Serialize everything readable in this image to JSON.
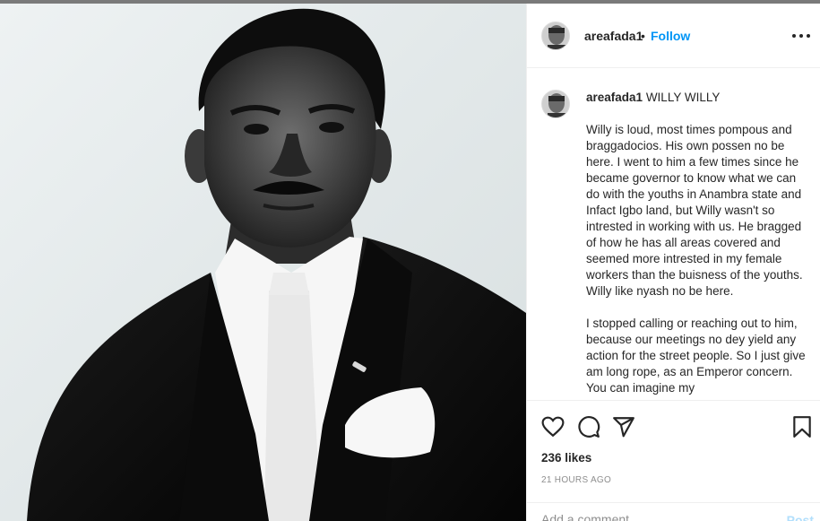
{
  "post": {
    "username": "areafada1",
    "follow_label": "Follow",
    "separator": "•",
    "caption_title": "WILLY WILLY",
    "caption_body": "Willy is loud, most times pompous and braggadocios. His own possen no be here. I went to him a few times since he became governor to know what we can do with the youths in Anambra state and Infact Igbo land, but Willy wasn't so intrested in working with us. He bragged of how he has all areas covered and seemed more intrested in my female workers than the buisness of the youths. Willy like nyash no be here.\n\nI stopped calling or reaching out to him, because our meetings no dey yield any action for the street people. So I just give am long rope, as an Emperor concern. You can imagine my",
    "likes": "236 likes",
    "time": "21 HOURS AGO",
    "comment_placeholder": "Add a comment...",
    "post_label": "Post"
  },
  "icons": {
    "more": "more-options-icon",
    "like": "heart-icon",
    "comment": "comment-icon",
    "share": "share-icon",
    "save": "bookmark-icon"
  },
  "colors": {
    "accent": "#0095f6",
    "post_disabled": "#b2dffc",
    "muted": "#8e8e8e"
  }
}
